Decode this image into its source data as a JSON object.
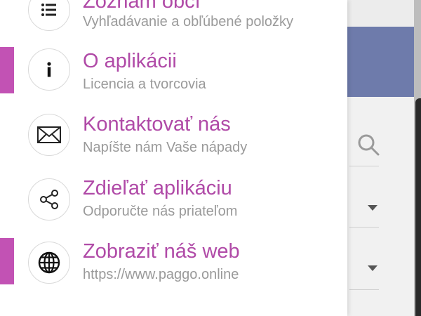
{
  "accent_color": "#c252b4",
  "title_color": "#b04aa7",
  "menu": [
    {
      "title": "Zoznam obcí",
      "subtitle": "Vyhľadávanie a obľúbené položky",
      "icon": "list-icon",
      "selected": false
    },
    {
      "title": "O aplikácii",
      "subtitle": "Licencia a tvorcovia",
      "icon": "info-icon",
      "selected": true
    },
    {
      "title": "Kontaktovať nás",
      "subtitle": "Napíšte nám Vaše nápady",
      "icon": "envelope-icon",
      "selected": false
    },
    {
      "title": "Zdieľať aplikáciu",
      "subtitle": "Odporučte nás priateľom",
      "icon": "share-icon",
      "selected": false
    },
    {
      "title": "Zobraziť náš web",
      "subtitle": "https://www.paggo.online",
      "icon": "globe-icon",
      "selected": true
    }
  ]
}
